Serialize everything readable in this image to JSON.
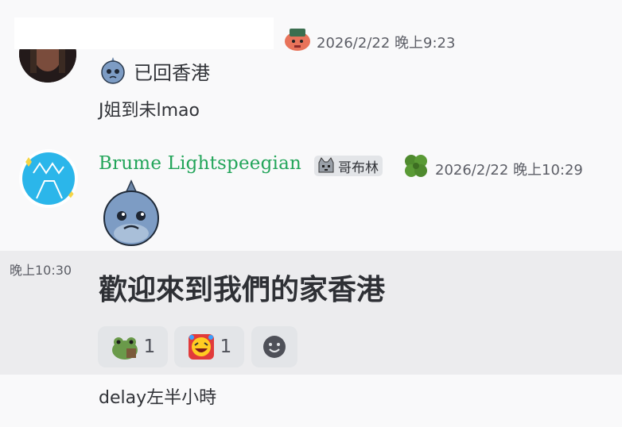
{
  "messages": [
    {
      "timestamp": "2026/2/22 晚上9:23",
      "status_line": "已回香港",
      "followups": [
        "J姐到未lmao"
      ]
    },
    {
      "author": "Brume Lightspeegian",
      "tag": "哥布林",
      "timestamp": "2026/2/22 晚上10:29",
      "hover_time": "晚上10:30",
      "text": "歡迎來到我們的家香港",
      "reactions": [
        {
          "icon": "frog-emoji",
          "count": "1"
        },
        {
          "icon": "laughing-emoji",
          "count": "1"
        }
      ]
    },
    {
      "text": "delay左半小時"
    }
  ],
  "colors": {
    "username": "#23a55a",
    "timestamp": "#5c5e66",
    "highlight_bg": "#ececee"
  }
}
